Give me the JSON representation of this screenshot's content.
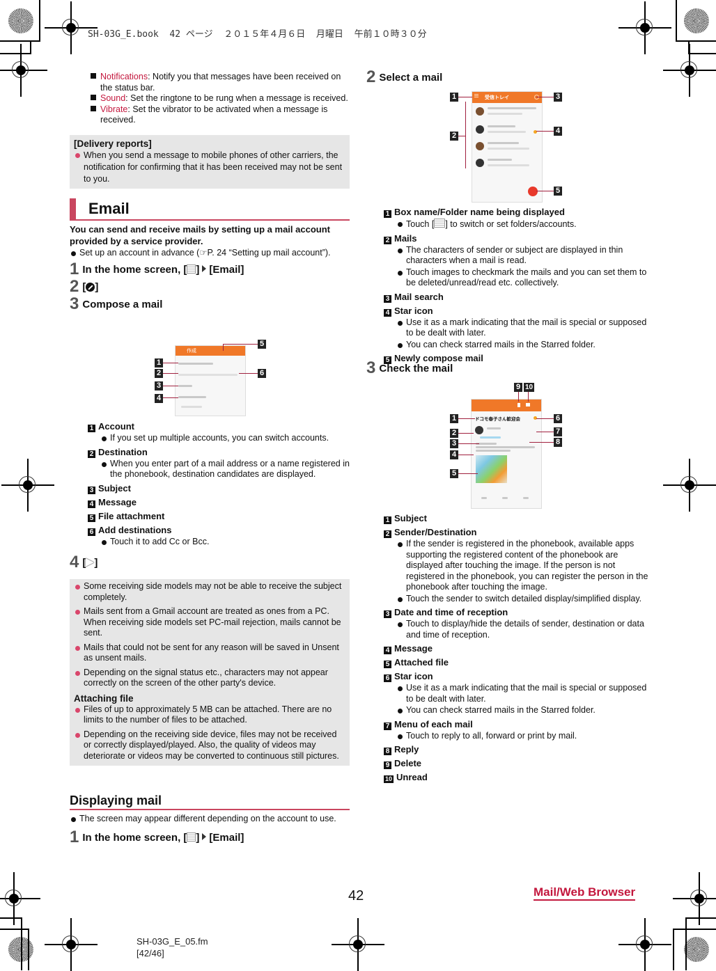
{
  "print_header": {
    "stamp": "SH-03G_E.book  42 ページ  ２０１５年４月６日  月曜日  午前１０時３０分"
  },
  "left": {
    "settings_items": [
      {
        "term": "Notifications",
        "text": ": Notify you that messages have been received on the status bar."
      },
      {
        "term": "Sound",
        "text": ": Set the ringtone to be rung when a message is received."
      },
      {
        "term": "Vibrate",
        "text": ": Set the vibrator to be activated when a message is received."
      }
    ],
    "delivery_box": {
      "title": "[Delivery reports]",
      "bullets": [
        "When you send a message to mobile phones of other carriers, the notification for confirming that it has been received may not be sent to you."
      ]
    },
    "email_section": {
      "title": "Email",
      "lead": "You can send and receive mails by setting up a mail account provided by a service provider.",
      "bullet": "Set up an account in advance (☞P. 24 “Setting up mail account”).",
      "steps": [
        {
          "num": "1",
          "pre": "In the home screen, [",
          "post": "]",
          "tail": "[Email]"
        },
        {
          "num": "2",
          "pre": "[",
          "post": "]"
        },
        {
          "num": "3",
          "text": "Compose a mail"
        },
        {
          "num": "4",
          "pre": "[",
          "post": "]"
        }
      ],
      "compose_callouts": [
        "1",
        "2",
        "3",
        "4",
        "5",
        "6"
      ],
      "compose_screen": {
        "title": "作成"
      },
      "items": [
        {
          "n": "1",
          "label": "Account",
          "bullets": [
            "If you set up multiple accounts, you can switch accounts."
          ]
        },
        {
          "n": "2",
          "label": "Destination",
          "bullets": [
            "When you enter part of a mail address or a name registered in the phonebook, destination candidates are displayed."
          ]
        },
        {
          "n": "3",
          "label": "Subject",
          "bullets": []
        },
        {
          "n": "4",
          "label": "Message",
          "bullets": []
        },
        {
          "n": "5",
          "label": "File attachment",
          "bullets": []
        },
        {
          "n": "6",
          "label": "Add destinations",
          "bullets": [
            "Touch it to add Cc or Bcc."
          ]
        }
      ],
      "notes_box": {
        "bullets": [
          "Some receiving side models may not be able to receive the subject completely.",
          "Mails sent from a Gmail account are treated as ones from a PC. When receiving side models set PC-mail rejection, mails cannot be sent.",
          "Mails that could not be sent for any reason will be saved in Unsent as unsent mails.",
          "Depending on the signal status etc., characters may not appear correctly on the screen of the other party's device."
        ],
        "attach_title": "Attaching file",
        "attach_bullets": [
          "Files of up to approximately 5 MB can be attached. There are no limits to the number of files to be attached.",
          "Depending on the receiving side device, files may not be received or correctly displayed/played. Also, the quality of videos may deteriorate or videos may be converted to continuous still pictures."
        ]
      }
    },
    "display_section": {
      "title": "Displaying mail",
      "bullet": "The screen may appear different depending on the account to use.",
      "step1": {
        "num": "1",
        "pre": "In the home screen, [",
        "post": "]",
        "tail": "[Email]"
      }
    }
  },
  "right": {
    "step2": {
      "num": "2",
      "text": "Select a mail"
    },
    "inbox_screen": {
      "title": "受信トレイ",
      "callouts": [
        "1",
        "2",
        "3",
        "4",
        "5"
      ]
    },
    "inbox_items": [
      {
        "n": "1",
        "label": "Box name/Folder name being displayed",
        "bullets": [
          {
            "pre": "Touch [",
            "post": "] to switch or set folders/accounts."
          }
        ]
      },
      {
        "n": "2",
        "label": "Mails",
        "bullets": [
          {
            "text": "The characters of sender or subject are displayed in thin characters when a mail is read."
          },
          {
            "text": "Touch images to checkmark the mails and you can set them to be deleted/unread/read etc. collectively."
          }
        ]
      },
      {
        "n": "3",
        "label": "Mail search",
        "bullets": []
      },
      {
        "n": "4",
        "label": "Star icon",
        "bullets": [
          {
            "text": "Use it as a mark indicating that the mail is special or supposed to be dealt with later."
          },
          {
            "text": "You can check starred mails in the Starred folder."
          }
        ]
      },
      {
        "n": "5",
        "label": "Newly compose mail",
        "bullets": []
      }
    ],
    "step3": {
      "num": "3",
      "text": "Check the mail"
    },
    "mail_screen": {
      "subject": "ドコモ春子さん歓迎会",
      "callouts": [
        "1",
        "2",
        "3",
        "4",
        "5",
        "6",
        "7",
        "8",
        "9",
        "10"
      ]
    },
    "mail_items": [
      {
        "n": "1",
        "label": "Subject",
        "bullets": []
      },
      {
        "n": "2",
        "label": "Sender/Destination",
        "bullets": [
          "If the sender is registered in the phonebook, available apps supporting the registered content of the phonebook are displayed after touching the image. If the person is not registered in the phonebook, you can register the person in the phonebook after touching the image.",
          "Touch the sender to switch detailed display/simplified display."
        ]
      },
      {
        "n": "3",
        "label": "Date and time of reception",
        "bullets": [
          "Touch to display/hide the details of sender, destination or data and time of reception."
        ]
      },
      {
        "n": "4",
        "label": "Message",
        "bullets": []
      },
      {
        "n": "5",
        "label": "Attached file",
        "bullets": []
      },
      {
        "n": "6",
        "label": "Star icon",
        "bullets": [
          "Use it as a mark indicating that the mail is special or supposed to be dealt with later.",
          "You can check starred mails in the Starred folder."
        ]
      },
      {
        "n": "7",
        "label": "Menu of each mail",
        "bullets": [
          "Touch to reply to all, forward or print by mail."
        ]
      },
      {
        "n": "8",
        "label": "Reply",
        "bullets": []
      },
      {
        "n": "9",
        "label": "Delete",
        "bullets": []
      },
      {
        "n": "10",
        "label": "Unread",
        "bullets": []
      }
    ]
  },
  "footer": {
    "page_number": "42",
    "category": "Mail/Web Browser",
    "file_name": "SH-03G_E_05.fm",
    "file_pages": "[42/46]"
  },
  "colors": {
    "accent": "#c3173d",
    "rule": "#c9465f",
    "note_bg": "#e6e6e6",
    "app_bar": "#f07828"
  }
}
